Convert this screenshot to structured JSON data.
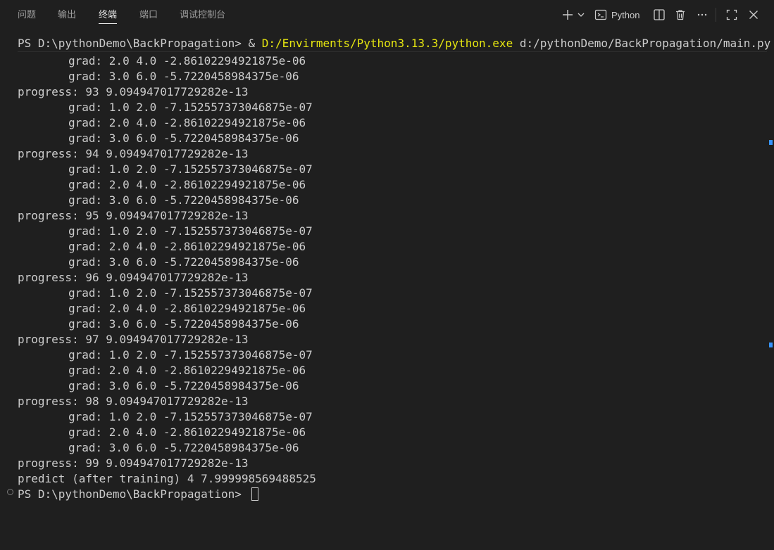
{
  "tabs": [
    {
      "label": "问题"
    },
    {
      "label": "输出"
    },
    {
      "label": "终端"
    },
    {
      "label": "端口"
    },
    {
      "label": "调试控制台"
    }
  ],
  "actions": {
    "shell_label": "Python"
  },
  "terminal": {
    "command": {
      "prefix": "PS D:\\pythonDemo\\BackPropagation> & ",
      "executable": "D:/Envirments/Python3.13.3/python.exe",
      "script": " d:/pythonDemo/BackPropagation/main.py"
    },
    "lines": [
      {
        "type": "grad",
        "text": "grad: 2.0 4.0 -2.86102294921875e-06"
      },
      {
        "type": "grad",
        "text": "grad: 3.0 6.0 -5.7220458984375e-06"
      },
      {
        "type": "progress",
        "text": "progress: 93 9.094947017729282e-13"
      },
      {
        "type": "grad",
        "text": "grad: 1.0 2.0 -7.152557373046875e-07"
      },
      {
        "type": "grad",
        "text": "grad: 2.0 4.0 -2.86102294921875e-06"
      },
      {
        "type": "grad",
        "text": "grad: 3.0 6.0 -5.7220458984375e-06"
      },
      {
        "type": "progress",
        "text": "progress: 94 9.094947017729282e-13"
      },
      {
        "type": "grad",
        "text": "grad: 1.0 2.0 -7.152557373046875e-07"
      },
      {
        "type": "grad",
        "text": "grad: 2.0 4.0 -2.86102294921875e-06"
      },
      {
        "type": "grad",
        "text": "grad: 3.0 6.0 -5.7220458984375e-06"
      },
      {
        "type": "progress",
        "text": "progress: 95 9.094947017729282e-13"
      },
      {
        "type": "grad",
        "text": "grad: 1.0 2.0 -7.152557373046875e-07"
      },
      {
        "type": "grad",
        "text": "grad: 2.0 4.0 -2.86102294921875e-06"
      },
      {
        "type": "grad",
        "text": "grad: 3.0 6.0 -5.7220458984375e-06"
      },
      {
        "type": "progress",
        "text": "progress: 96 9.094947017729282e-13"
      },
      {
        "type": "grad",
        "text": "grad: 1.0 2.0 -7.152557373046875e-07"
      },
      {
        "type": "grad",
        "text": "grad: 2.0 4.0 -2.86102294921875e-06"
      },
      {
        "type": "grad",
        "text": "grad: 3.0 6.0 -5.7220458984375e-06"
      },
      {
        "type": "progress",
        "text": "progress: 97 9.094947017729282e-13"
      },
      {
        "type": "grad",
        "text": "grad: 1.0 2.0 -7.152557373046875e-07"
      },
      {
        "type": "grad",
        "text": "grad: 2.0 4.0 -2.86102294921875e-06"
      },
      {
        "type": "grad",
        "text": "grad: 3.0 6.0 -5.7220458984375e-06"
      },
      {
        "type": "progress",
        "text": "progress: 98 9.094947017729282e-13"
      },
      {
        "type": "grad",
        "text": "grad: 1.0 2.0 -7.152557373046875e-07"
      },
      {
        "type": "grad",
        "text": "grad: 2.0 4.0 -2.86102294921875e-06"
      },
      {
        "type": "grad",
        "text": "grad: 3.0 6.0 -5.7220458984375e-06"
      },
      {
        "type": "progress",
        "text": "progress: 99 9.094947017729282e-13"
      },
      {
        "type": "result",
        "text": "predict (after training) 4 7.999998569488525"
      }
    ],
    "prompt": "PS D:\\pythonDemo\\BackPropagation> "
  },
  "colors": {
    "background": "#1f1f1f",
    "text": "#cccccc",
    "path_highlight": "#e5e510",
    "scroll_marker": "#3794ff"
  },
  "icons": [
    "plus-icon",
    "chevron-down-icon",
    "terminal-icon",
    "split-icon",
    "trash-icon",
    "more-icon",
    "maximize-icon",
    "close-icon"
  ]
}
